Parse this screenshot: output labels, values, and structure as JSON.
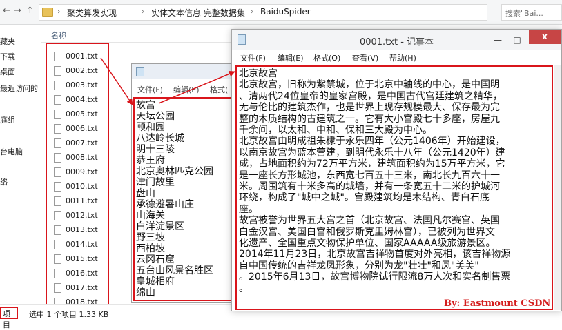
{
  "explorer": {
    "breadcrumb": [
      "聚类算发实现",
      "实体文本信息 完整数据集",
      "BaiduSpider"
    ],
    "search_placeholder": "搜索\"Bai...",
    "nav_items": [
      "藏夹",
      "下载",
      "桌面",
      "最近访问的",
      "庭组",
      "台电脑",
      "络"
    ],
    "column_name": "名称",
    "files": [
      "0001.txt",
      "0002.txt",
      "0003.txt",
      "0004.txt",
      "0005.txt",
      "0006.txt",
      "0007.txt",
      "0008.txt",
      "0009.txt",
      "0010.txt",
      "0011.txt",
      "0012.txt",
      "0013.txt",
      "0014.txt",
      "0015.txt",
      "0016.txt",
      "0017.txt",
      "0018.txt"
    ],
    "status_count": "项目",
    "status_text": "选中 1 个项目  1.33 KB"
  },
  "bg_notepad": {
    "menu": [
      "文件(F)",
      "编辑(E)",
      "格式("
    ],
    "lines": [
      "故宫",
      "天坛公园",
      "颐和园",
      "八达岭长城",
      "明十三陵",
      "恭王府",
      "北京奥林匹克公园",
      "津门故里",
      "盘山",
      "承德避暑山庄",
      "山海关",
      "白洋淀景区",
      "野三坡",
      "西柏坡",
      "云冈石窟",
      "五台山风景名胜区",
      "皇城相府",
      "绵山"
    ]
  },
  "notepad": {
    "title": "0001.txt - 记事本",
    "menu": [
      "文件(F)",
      "编辑(E)",
      "格式(O)",
      "查看(V)",
      "帮助(H)"
    ],
    "lines": [
      "北京故宫",
      "北京故宫，旧称为紫禁城，位于北京中轴线的中心，是中国明",
      "、清两代24位皇帝的皇家宫殿，是中国古代宫廷建筑之精华，",
      "无与伦比的建筑杰作，也是世界上现存规模最大、保存最为完",
      "整的木质结构的古建筑之一。它有大小宫殿七十多座，房屋九",
      "千余间，以太和、中和、保和三大殿为中心。",
      "北京故宫由明成祖朱棣于永乐四年（公元1406年）开始建设，",
      "以南京故宫为蓝本营建，到明代永乐十八年（公元1420年）建",
      "成，占地面积约为72万平方米，建筑面积约为15万平方米，它",
      "是一座长方形城池，东西宽七百五十三米，南北长九百六十一",
      "米。周围筑有十米多高的城墙，并有一条宽五十二米的护城河",
      "环绕，构成了\"城中之城\"。宫殿建筑均是木结构、青白石底",
      "座。",
      "故宫被誉为世界五大宫之首（北京故宫、法国凡尔赛宫、英国",
      "白金汉宫、美国白宫和俄罗斯克里姆林宫），已被列为世界文",
      "化遗产、全国重点文物保护单位、国家AAAAA级旅游景区。",
      "2014年11月23日，北京故宫吉祥物首度对外亮相，该吉祥物源",
      "自中国传统的吉祥龙凤形象，分别为龙\"壮壮\"和凤\"美美\"",
      "。2015年6月13日，故宫博物院试行限流8万人次和实名制售票",
      "。"
    ],
    "signature": "By: Eastmount CSDN",
    "close_glyph": "x"
  },
  "colors": {
    "annotation": "#d9151b",
    "signature": "#d41e1e"
  }
}
